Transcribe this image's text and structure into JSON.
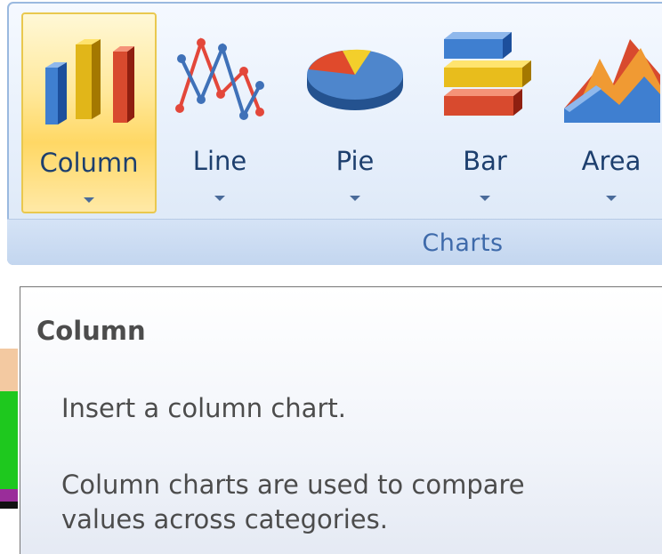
{
  "ribbon": {
    "group_label": "Charts",
    "buttons": [
      {
        "label": "Column",
        "icon": "column-chart-icon",
        "selected": true
      },
      {
        "label": "Line",
        "icon": "line-chart-icon",
        "selected": false
      },
      {
        "label": "Pie",
        "icon": "pie-chart-icon",
        "selected": false
      },
      {
        "label": "Bar",
        "icon": "bar-chart-icon",
        "selected": false
      },
      {
        "label": "Area",
        "icon": "area-chart-icon",
        "selected": false
      }
    ]
  },
  "tooltip": {
    "title": "Column",
    "description": "Insert a column chart.",
    "detail_line1": "Column charts are used to compare",
    "detail_line2": "values across categories."
  },
  "colors": {
    "accent_selected": "#ffd865",
    "ribbon_border": "#9ab9df",
    "label_text": "#1d3f6e",
    "group_label_text": "#3e6aaa"
  }
}
